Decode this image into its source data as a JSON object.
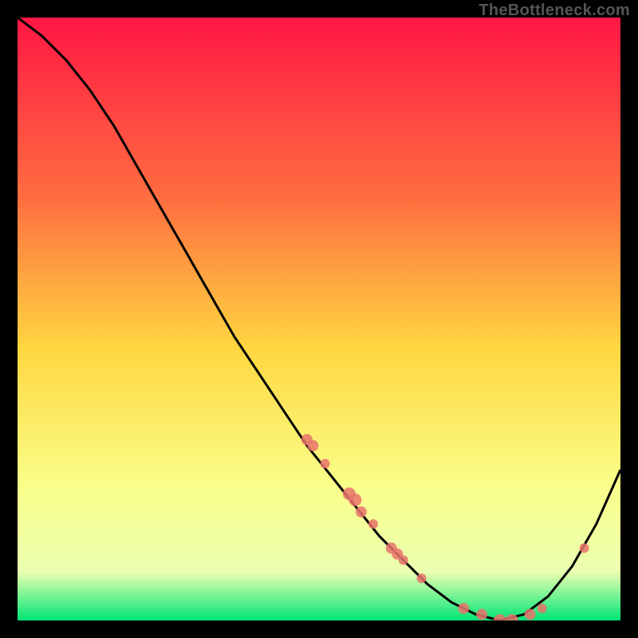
{
  "watermark": "TheBottleneck.com",
  "chart_data": {
    "type": "line",
    "title": "",
    "xlabel": "",
    "ylabel": "",
    "x_range": [
      0,
      100
    ],
    "y_range": [
      0,
      100
    ],
    "grid": false,
    "legend": false,
    "gradient_stops": [
      {
        "offset": 0.0,
        "color": "#ff1744"
      },
      {
        "offset": 0.3,
        "color": "#ff6e40"
      },
      {
        "offset": 0.55,
        "color": "#ffd740"
      },
      {
        "offset": 0.78,
        "color": "#f9ff8a"
      },
      {
        "offset": 0.92,
        "color": "#eaffb0"
      },
      {
        "offset": 1.0,
        "color": "#00e676"
      }
    ],
    "series": [
      {
        "name": "bottleneck-curve",
        "x": [
          0,
          4,
          8,
          12,
          16,
          20,
          24,
          28,
          32,
          36,
          40,
          44,
          48,
          52,
          56,
          60,
          64,
          68,
          72,
          76,
          80,
          84,
          88,
          92,
          96,
          100
        ],
        "y": [
          100,
          97,
          93,
          88,
          82,
          75,
          68,
          61,
          54,
          47,
          41,
          35,
          29,
          24,
          19,
          14,
          10,
          6,
          3,
          1,
          0,
          1,
          4,
          9,
          16,
          25
        ]
      }
    ],
    "markers": {
      "name": "highlight-points",
      "color": "#e8736b",
      "points": [
        {
          "x": 48,
          "y": 30,
          "r": 7
        },
        {
          "x": 49,
          "y": 29,
          "r": 7
        },
        {
          "x": 51,
          "y": 26,
          "r": 6
        },
        {
          "x": 55,
          "y": 21,
          "r": 8
        },
        {
          "x": 56,
          "y": 20,
          "r": 8
        },
        {
          "x": 57,
          "y": 18,
          "r": 7
        },
        {
          "x": 59,
          "y": 16,
          "r": 6
        },
        {
          "x": 62,
          "y": 12,
          "r": 7
        },
        {
          "x": 63,
          "y": 11,
          "r": 7
        },
        {
          "x": 64,
          "y": 10,
          "r": 6
        },
        {
          "x": 67,
          "y": 7,
          "r": 6
        },
        {
          "x": 74,
          "y": 2,
          "r": 7
        },
        {
          "x": 77,
          "y": 1,
          "r": 7
        },
        {
          "x": 80,
          "y": 0,
          "r": 8
        },
        {
          "x": 82,
          "y": 0,
          "r": 8
        },
        {
          "x": 85,
          "y": 1,
          "r": 7
        },
        {
          "x": 87,
          "y": 2,
          "r": 6
        },
        {
          "x": 94,
          "y": 12,
          "r": 6
        }
      ]
    }
  }
}
